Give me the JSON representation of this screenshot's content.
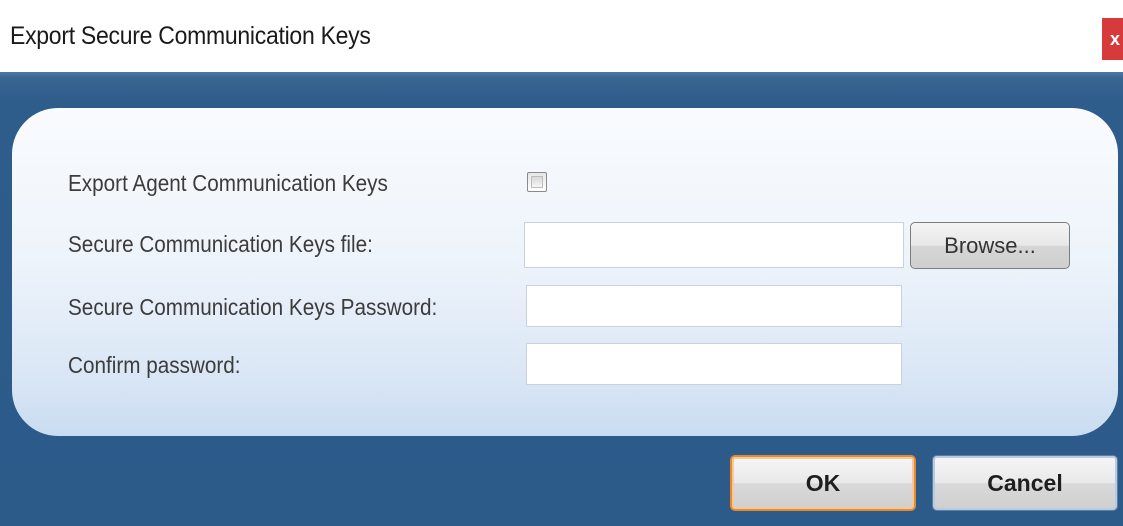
{
  "dialog": {
    "title": "Export Secure Communication Keys",
    "close_label": "x"
  },
  "form": {
    "export_agent_keys_label": "Export Agent Communication Keys",
    "export_agent_keys_checked": false,
    "keys_file_label": "Secure Communication Keys file:",
    "keys_file_value": "",
    "browse_label": "Browse...",
    "password_label": "Secure Communication Keys Password:",
    "password_value": "",
    "confirm_password_label": "Confirm password:",
    "confirm_password_value": ""
  },
  "actions": {
    "ok_label": "OK",
    "cancel_label": "Cancel"
  },
  "colors": {
    "frame_blue": "#2e5c8b",
    "close_red": "#d63a3a",
    "default_button_border": "#e58a2f"
  },
  "icons": {
    "close": "close-icon"
  }
}
